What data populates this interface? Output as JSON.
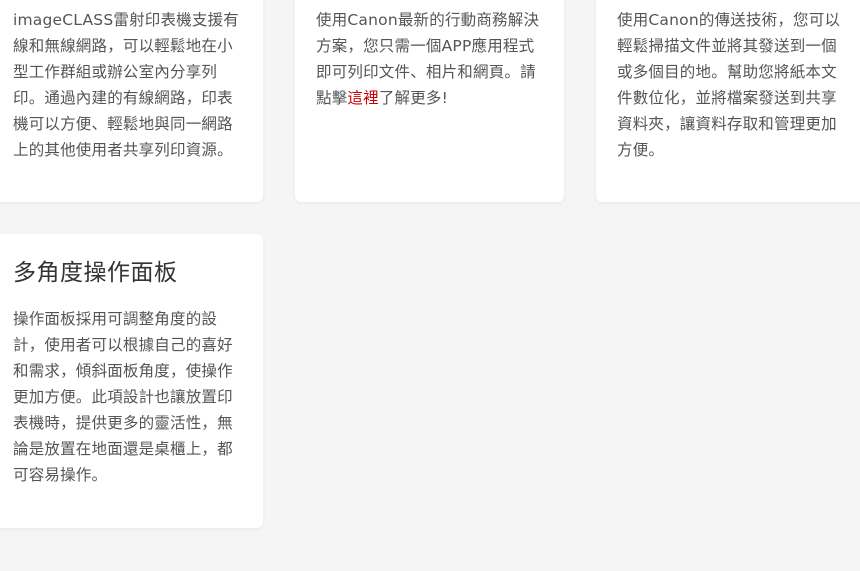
{
  "cards": [
    {
      "lines": [
        "imageCLASS雷射印表機支援有",
        "線和無線網路，可以輕鬆地在小",
        "型工作群組或辦公室內分享列",
        "印。通過內建的有線網路，印表",
        "機可以方便、輕鬆地與同一網路",
        "上的其他使用者共享列印資源。"
      ]
    },
    {
      "lines": [
        "使用Canon最新的行動商務解決",
        "方案，您只需一個APP應用程式",
        "即可列印文件、相片和網頁。請"
      ],
      "last_line_prefix": "點擊",
      "link_text": "這裡",
      "last_line_suffix": "了解更多!"
    },
    {
      "lines": [
        "使用Canon的傳送技術，您可以",
        "輕鬆掃描文件並將其發送到一個",
        "或多個目的地。幫助您將紙本文",
        "件數位化，並將檔案發送到共享",
        "資料夾，讓資料存取和管理更加",
        "方便。"
      ]
    },
    {
      "title": "多角度操作面板",
      "lines": [
        "操作面板採用可調整角度的設",
        "計，使用者可以根據自己的喜好",
        "和需求，傾斜面板角度，使操作",
        "更加方便。此項設計也讓放置印",
        "表機時，提供更多的靈活性，無",
        "論是放置在地面還是桌櫃上，都",
        "可容易操作。"
      ]
    }
  ],
  "colors": {
    "background": "#f5f5f5",
    "card": "#ffffff",
    "text": "#555555",
    "title": "#333333",
    "link": "#cc0000"
  }
}
